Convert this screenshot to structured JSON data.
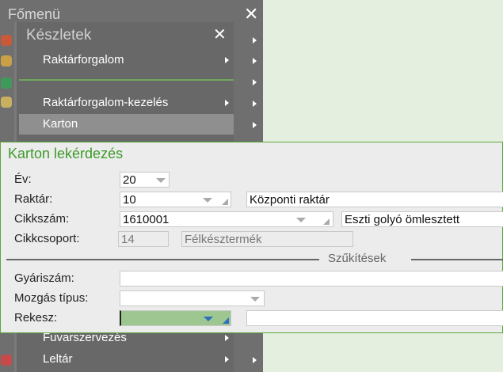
{
  "main_menu": {
    "title": "Főmenü"
  },
  "submenu": {
    "title": "Készletek",
    "items": [
      {
        "label": "Raktárforgalom"
      },
      {
        "label": "Raktárforgalom-kezelés"
      },
      {
        "label": "Karton"
      },
      {
        "label": "Fuvarszervezés"
      },
      {
        "label": "Leltár"
      }
    ]
  },
  "dialog": {
    "title": "Karton lekérdezés",
    "fields": {
      "ev": {
        "label": "Év:",
        "value": "20"
      },
      "raktar": {
        "label": "Raktár:",
        "value": "10",
        "desc": "Központi raktár"
      },
      "cikkszam": {
        "label": "Cikkszám:",
        "value": "1610001",
        "desc": "Eszti golyó ömlesztett"
      },
      "cikkcsoport": {
        "label": "Cikkcsoport:",
        "value": "14",
        "desc": "Félkésztermék"
      },
      "section": "Szűkítések",
      "gyariszam": {
        "label": "Gyáriszám:",
        "value": ""
      },
      "mozgas": {
        "label": "Mozgás típus:",
        "value": ""
      },
      "rekesz": {
        "label": "Rekesz:",
        "value": "",
        "desc": ""
      }
    }
  },
  "colors": {
    "accent": "#3d9a2a",
    "menu": "#6f6f6f",
    "focus": "#9ec690"
  }
}
